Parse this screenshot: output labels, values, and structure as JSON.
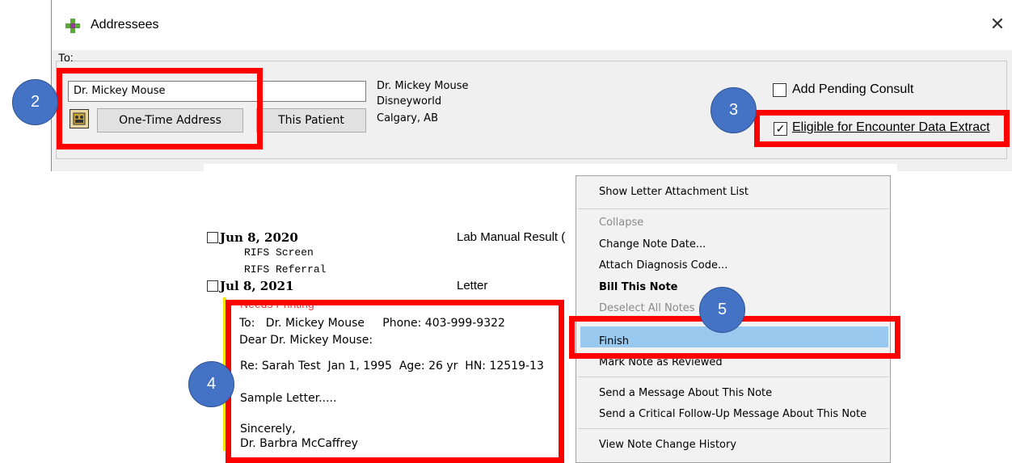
{
  "dialog": {
    "title": "Addressees",
    "close_glyph": "✕",
    "group_label": "To:",
    "to_value": "Dr. Mickey Mouse",
    "one_time_address_label": "One-Time Address",
    "this_patient_label": "This Patient",
    "address_lines": [
      "Dr. Mickey Mouse",
      "Disneyworld",
      "Calgary, AB"
    ],
    "add_pending_consult": {
      "label": "Add Pending Consult",
      "checked": false
    },
    "eligible_extract": {
      "label": "Eligible for Encounter Data Extract",
      "checked": true,
      "check_glyph": "✓"
    },
    "icons": [
      "app-logo-icon",
      "address-book-icon",
      "close-icon"
    ]
  },
  "notes": [
    {
      "date": "Jun 8, 2020",
      "type": "Lab Manual Result (",
      "sub": [
        "RIFS Screen",
        "RIFS Referral"
      ]
    },
    {
      "date": "Jul 8, 2021",
      "type": "Letter",
      "status": "Needs Printing"
    }
  ],
  "letter": {
    "to_line": "To:   Dr. Mickey Mouse     Phone: 403-999-9322",
    "greeting": "Dear Dr. Mickey Mouse:",
    "re_line": "Re: Sarah Test  Jan 1, 1995  Age: 26 yr  HN: 12519-13",
    "body": "Sample Letter.....",
    "closing": "Sincerely,",
    "signature": "Dr. Barbra McCaffrey"
  },
  "context_menu": {
    "items": [
      {
        "label": "Show Letter Attachment List",
        "enabled": true
      },
      {
        "label": "Collapse",
        "enabled": false
      },
      {
        "label": "Change Note Date...",
        "enabled": true
      },
      {
        "label": "Attach Diagnosis Code...",
        "enabled": true
      },
      {
        "label": "Bill This Note",
        "enabled": true
      },
      {
        "label": "Deselect All Notes",
        "enabled": false
      },
      {
        "label": "Finish",
        "enabled": true,
        "highlighted": true
      },
      {
        "label": "Mark Note as Reviewed",
        "enabled": true
      },
      {
        "label": "Send a Message About This Note",
        "enabled": true
      },
      {
        "label": "Send a Critical Follow-Up Message About This Note",
        "enabled": true
      },
      {
        "label": "View Note Change History",
        "enabled": true
      }
    ]
  },
  "annotations": [
    "2",
    "3",
    "4",
    "5"
  ],
  "colors": {
    "annotation_box": "#ff0000",
    "bubble": "#4472c4",
    "menu_highlight": "#99c9ef",
    "needs_printing": "#e23b3b",
    "change_bar": "#f5e400"
  }
}
